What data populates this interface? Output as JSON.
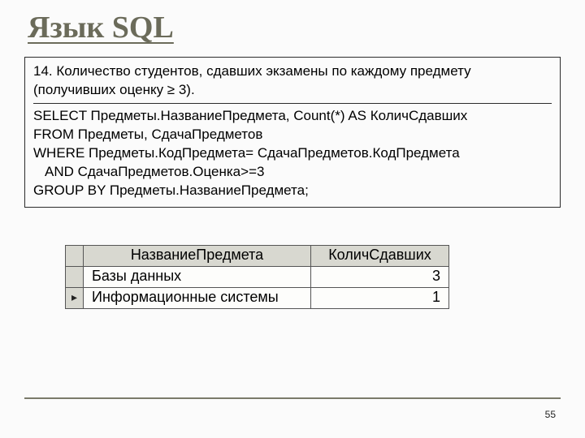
{
  "title": "Язык SQL",
  "query": {
    "prompt": "14. Количество студентов, сдавших экзамены по каждому предмету (получивших оценку ≥ 3).",
    "lines": {
      "select": "SELECT Предметы.НазваниеПредмета, Count(*) AS КоличСдавших",
      "from": "FROM Предметы, СдачаПредметов",
      "where": "WHERE Предметы.КодПредмета= СдачаПредметов.КодПредмета",
      "and": "AND СдачаПредметов.Оценка>=3",
      "group": "GROUP BY Предметы.НазваниеПредмета;"
    }
  },
  "result": {
    "headers": {
      "name": "НазваниеПредмета",
      "count": "КоличСдавших"
    },
    "rows": [
      {
        "pointer": "",
        "name": "Базы данных",
        "count": "3"
      },
      {
        "pointer": "▸",
        "name": "Информационные системы",
        "count": "1"
      }
    ]
  },
  "page": "55"
}
